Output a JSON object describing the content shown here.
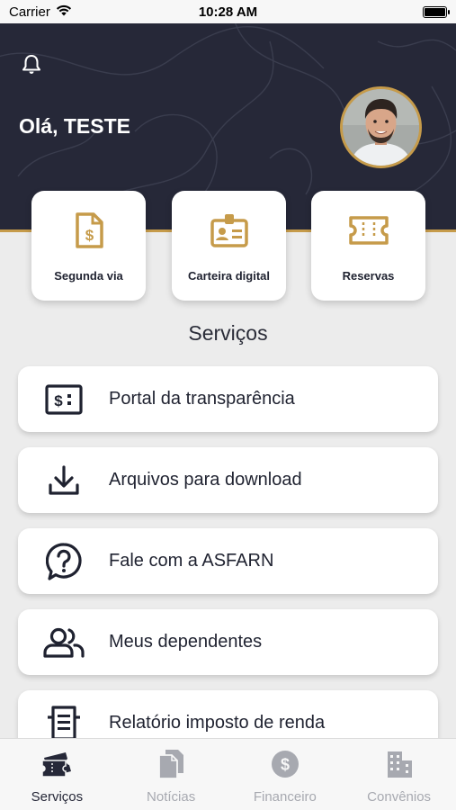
{
  "status_bar": {
    "carrier": "Carrier",
    "time": "10:28 AM"
  },
  "header": {
    "greeting": "Olá, TESTE"
  },
  "quick_actions": [
    {
      "label": "Segunda via",
      "icon": "invoice-dollar-icon"
    },
    {
      "label": "Carteira digital",
      "icon": "id-card-icon"
    },
    {
      "label": "Reservas",
      "icon": "ticket-icon"
    }
  ],
  "services": {
    "title": "Serviços",
    "items": [
      {
        "label": "Portal da transparência",
        "icon": "money-screen-icon"
      },
      {
        "label": "Arquivos para download",
        "icon": "download-icon"
      },
      {
        "label": "Fale com a ASFARN",
        "icon": "question-bubble-icon"
      },
      {
        "label": "Meus dependentes",
        "icon": "users-icon"
      },
      {
        "label": "Relatório imposto de renda",
        "icon": "receipt-icon"
      }
    ]
  },
  "tab_bar": {
    "tabs": [
      {
        "label": "Serviços",
        "icon": "ticket-icon",
        "active": true
      },
      {
        "label": "Notícias",
        "icon": "documents-icon",
        "active": false
      },
      {
        "label": "Financeiro",
        "icon": "dollar-circle-icon",
        "active": false
      },
      {
        "label": "Convênios",
        "icon": "buildings-icon",
        "active": false
      }
    ]
  },
  "colors": {
    "header_bg": "#262838",
    "accent_gold": "#c69b4a",
    "page_bg": "#ececec",
    "tab_inactive": "#a7a9b0"
  }
}
